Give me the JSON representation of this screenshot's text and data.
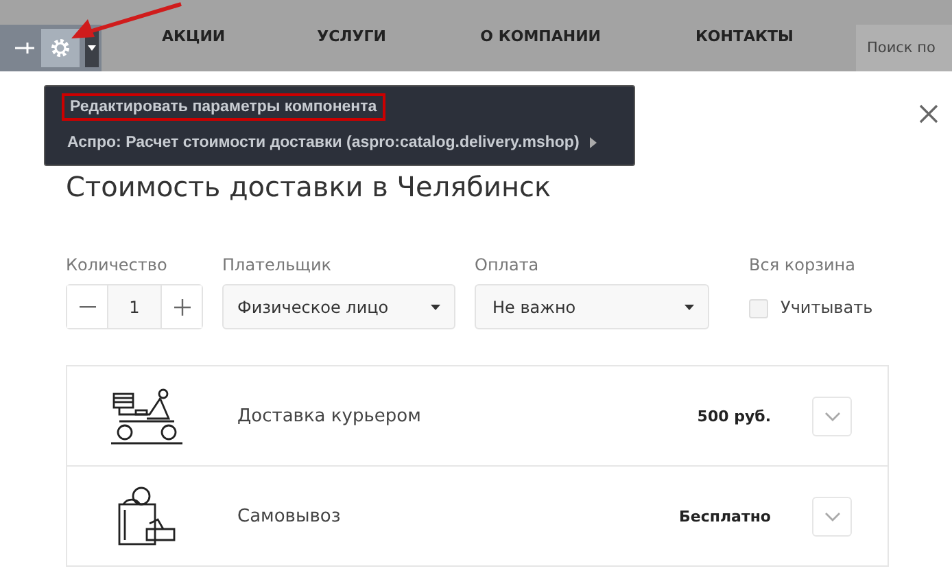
{
  "toolbar": {
    "menu": [
      {
        "label": "Редактировать параметры компонента",
        "highlighted": true,
        "submenu": false
      },
      {
        "label": "Аспро: Расчет стоимости доставки (aspro:catalog.delivery.mshop)",
        "highlighted": false,
        "submenu": true
      }
    ]
  },
  "nav": [
    "АКЦИИ",
    "УСЛУГИ",
    "О КОМПАНИИ",
    "КОНТАКТЫ"
  ],
  "search": {
    "placeholder": "Поиск по"
  },
  "title": "Стоимость доставки в Челябинск",
  "form": {
    "quantity": {
      "label": "Количество",
      "value": "1"
    },
    "payer": {
      "label": "Плательщик",
      "value": "Физическое лицо"
    },
    "payment": {
      "label": "Оплата",
      "value": "Не важно"
    },
    "cart": {
      "label": "Вся корзина",
      "checkbox": "Учитывать",
      "checked": false
    }
  },
  "methods": [
    {
      "kind": "courier",
      "name": "Доставка курьером",
      "price": "500 руб."
    },
    {
      "kind": "pickup",
      "name": "Самовывоз",
      "price": "Бесплатно"
    }
  ]
}
